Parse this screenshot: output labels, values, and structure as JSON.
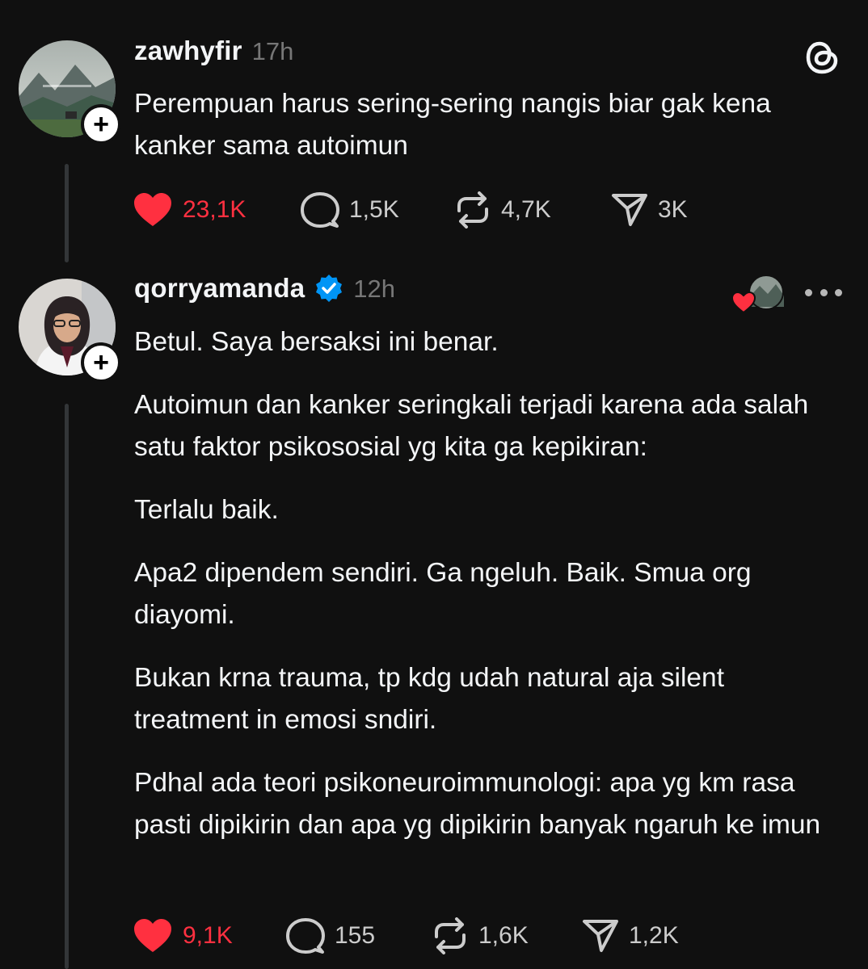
{
  "colors": {
    "background": "#101010",
    "text": "#f3f5f7",
    "muted": "#777777",
    "like_red": "#ff3040",
    "verified_blue": "#0095f6"
  },
  "posts": [
    {
      "username": "zawhyfir",
      "time": "17h",
      "verified": false,
      "avatar_icon": "landscape-avatar",
      "paragraphs": [
        "Perempuan harus sering-sering nangis biar gak kena kanker sama autoimun"
      ],
      "likes": "23,1K",
      "replies": "1,5K",
      "reposts": "4,7K",
      "shares": "3K",
      "liked": true
    },
    {
      "username": "qorryamanda",
      "time": "12h",
      "verified": true,
      "avatar_icon": "person-avatar",
      "paragraphs": [
        "Betul. Saya bersaksi ini benar.",
        "Autoimun dan kanker seringkali terjadi karena ada salah satu faktor psikososial yg kita ga kepikiran:",
        "Terlalu baik.",
        "Apa2 dipendem sendiri. Ga ngeluh. Baik. Smua org diayomi.",
        "Bukan krna trauma, tp kdg udah natural aja silent treatment in emosi sndiri.",
        "Pdhal ada teori psikoneuroimmunologi: apa yg km rasa pasti dipikirin dan apa yg dipikirin banyak ngaruh ke imun"
      ],
      "likes": "9,1K",
      "replies": "155",
      "reposts": "1,6K",
      "shares": "1,2K",
      "liked": true
    }
  ]
}
